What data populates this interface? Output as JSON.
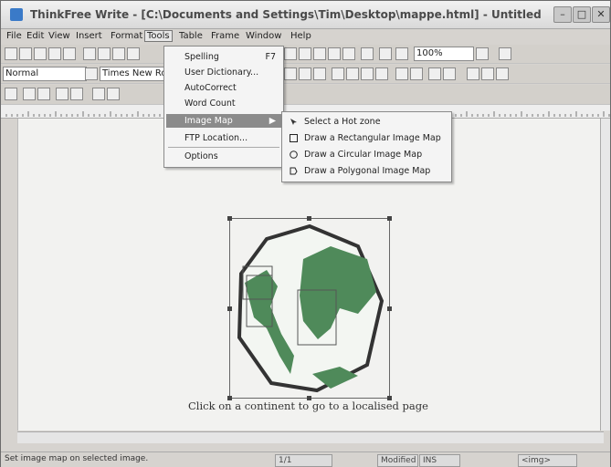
{
  "window": {
    "title": "ThinkFree Write - [C:\\Documents and Settings\\Tim\\Desktop\\mappe.html] - Untitled"
  },
  "menubar": [
    "File",
    "Edit",
    "View",
    "Insert",
    "Format",
    "Tools",
    "Table",
    "Frame",
    "Window",
    "Help"
  ],
  "toolbar": {
    "style_combo": "Normal",
    "font_combo": "Times New Ro",
    "zoom_combo": "100%"
  },
  "tools_menu": {
    "items": [
      {
        "label": "Spelling",
        "shortcut": "F7"
      },
      {
        "label": "User Dictionary...",
        "shortcut": ""
      },
      {
        "label": "AutoCorrect",
        "shortcut": ""
      },
      {
        "label": "Word Count",
        "shortcut": ""
      },
      {
        "label": "Image Map",
        "shortcut": ""
      },
      {
        "label": "FTP Location...",
        "shortcut": ""
      },
      {
        "label": "Options",
        "shortcut": ""
      }
    ]
  },
  "image_map_submenu": {
    "items": [
      {
        "label": "Select a Hot zone",
        "icon": "pointer-icon"
      },
      {
        "label": "Draw a Rectangular Image Map",
        "icon": "rectangle-icon"
      },
      {
        "label": "Draw a Circular Image Map",
        "icon": "circle-icon"
      },
      {
        "label": "Draw a Polygonal Image Map",
        "icon": "polygon-icon"
      }
    ]
  },
  "document": {
    "caption": "Click on a continent to go to a localised page"
  },
  "statusbar": {
    "message": "Set image map on selected image.",
    "page": "1/1",
    "modified": "Modified",
    "mode": "INS",
    "tag": "<img>"
  },
  "colors": {
    "menu_highlight": "#8b8b8b",
    "land": "#4f8a5a",
    "globe_outline": "#333333"
  }
}
